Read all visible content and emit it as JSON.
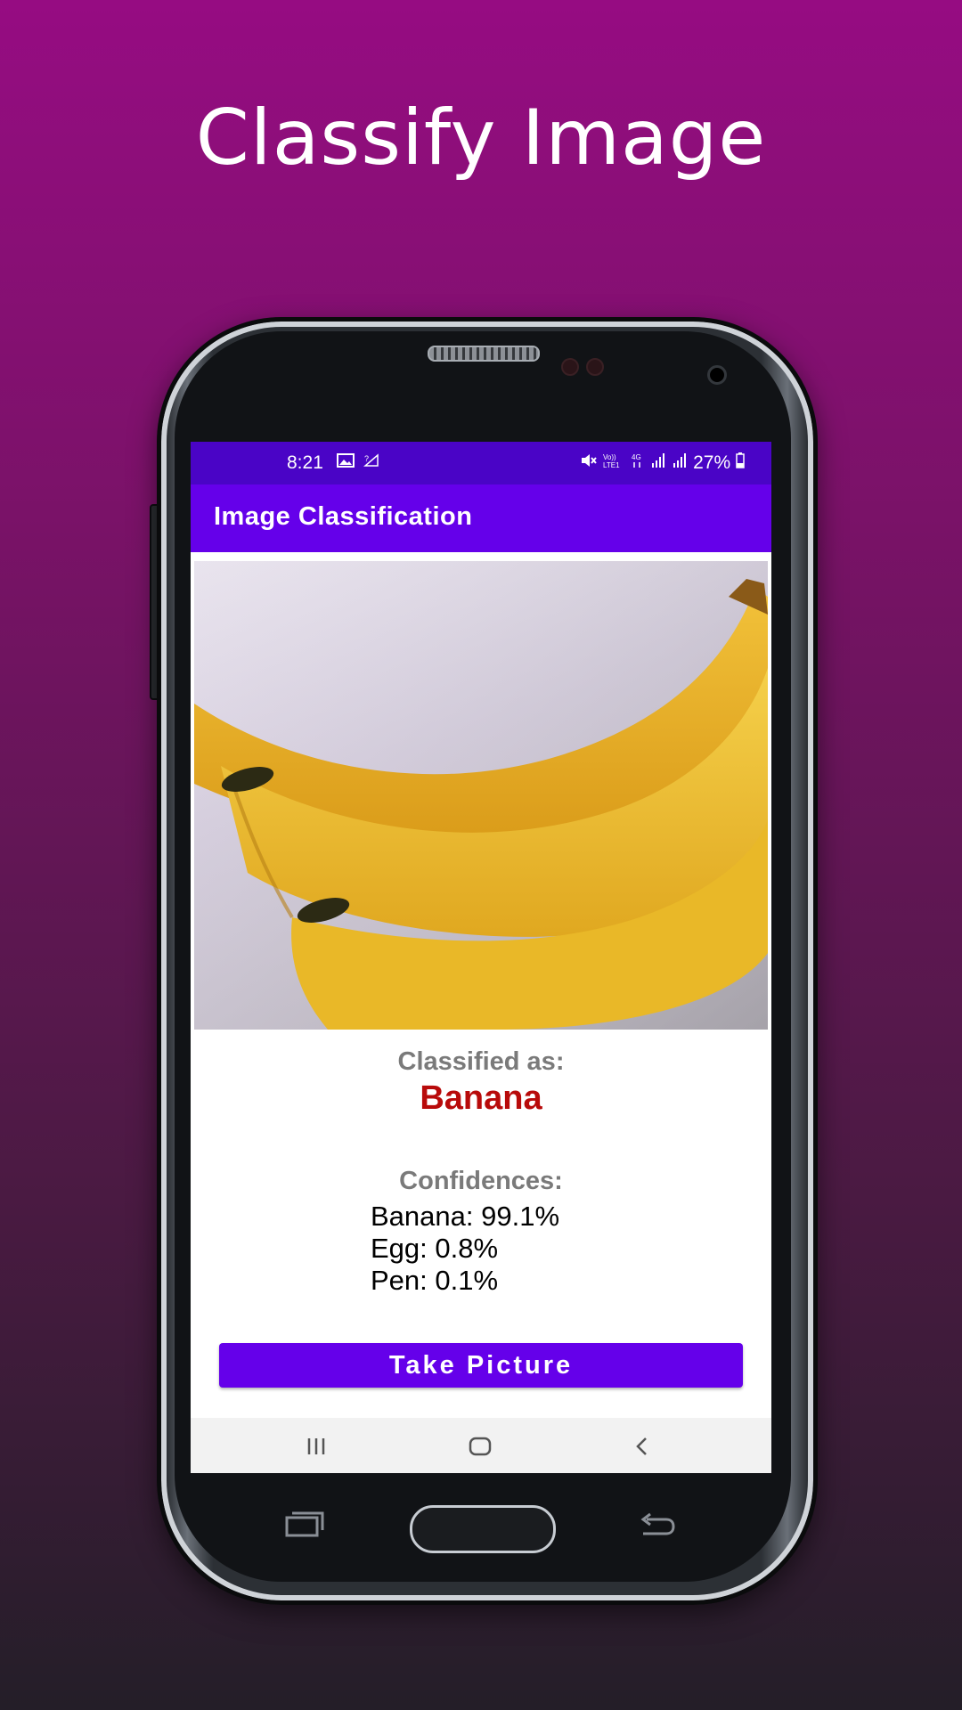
{
  "headline": "Classify Image",
  "status_bar": {
    "time": "8:21",
    "left_icons": [
      "gallery-icon",
      "no-sim-icon"
    ],
    "right_icons": [
      "mute-icon",
      "volte-icon",
      "4g-icon",
      "signal-icon",
      "signal-icon"
    ],
    "battery_text": "27%"
  },
  "app_bar": {
    "title": "Image Classification"
  },
  "result": {
    "classified_label": "Classified as:",
    "classified_value": "Banana",
    "confidences_label": "Confidences:",
    "confidences": [
      "Banana: 99.1%",
      "Egg: 0.8%",
      "Pen: 0.1%"
    ]
  },
  "take_picture_label": "Take Picture",
  "nav_bar": {
    "recents": "recents-icon",
    "home": "home-icon",
    "back": "back-icon"
  },
  "colors": {
    "status_bar": "#4a04c6",
    "app_bar": "#6500ea",
    "result_red": "#b80a0a",
    "background_top": "#960c82",
    "background_bottom": "#241e28"
  }
}
